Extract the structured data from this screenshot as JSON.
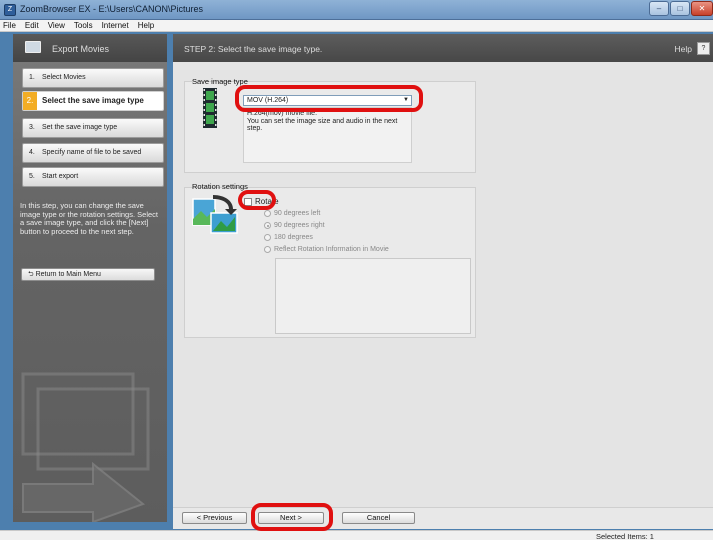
{
  "window": {
    "title": "ZoomBrowser EX  -  E:\\Users\\CANON\\Pictures",
    "controls": {
      "minimize": "–",
      "maximize": "□",
      "close": "✕"
    }
  },
  "menu": [
    "File",
    "Edit",
    "View",
    "Tools",
    "Internet",
    "Help"
  ],
  "left": {
    "title": "Export Movies",
    "steps": [
      {
        "num": "1.",
        "label": "Select Movies"
      },
      {
        "num": "2.",
        "label": "Select the save image type"
      },
      {
        "num": "3.",
        "label": "Set the save image type"
      },
      {
        "num": "4.",
        "label": "Specify name of file to be saved"
      },
      {
        "num": "5.",
        "label": "Start export"
      }
    ],
    "active_step": 1,
    "info": "In this step, you can change the save image type or the rotation settings. Select a save image type, and click the [Next] button to proceed to the next step.",
    "return_label": "Return to Main Menu",
    "return_icon": "return-arrow-icon"
  },
  "main": {
    "step_title": "STEP 2: Select the save image type.",
    "help_label": "Help",
    "help_icon": "?",
    "save_group": {
      "label": "Save image type",
      "selected": "MOV (H.264)",
      "description_line1": "H.264(mov) movie file.",
      "description_line2": "You can set the image size and audio in the next step.",
      "icon": "film-strip-icon"
    },
    "rotation_group": {
      "label": "Rotation settings",
      "rotate_label": "Rotate",
      "rotate_checked": false,
      "options": [
        "90 degrees left",
        "90 degrees right",
        "180 degrees",
        "Reflect Rotation Information in Movie"
      ],
      "selected_option": 1,
      "icon": "rotate-image-icon"
    }
  },
  "buttons": {
    "previous": "< Previous",
    "next": "Next >",
    "cancel": "Cancel"
  },
  "status": {
    "text": "Selected Items: 1"
  },
  "colors": {
    "accent": "#f3ad25",
    "highlight": "#e01010",
    "panel_dark": "#5d5d5d"
  }
}
